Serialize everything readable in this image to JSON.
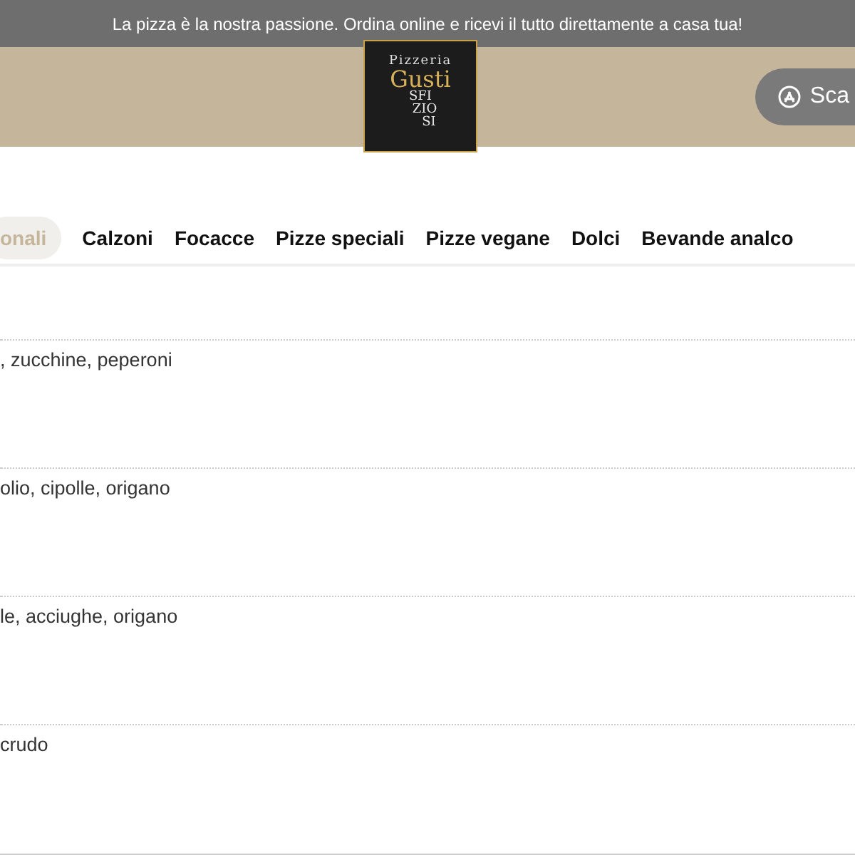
{
  "announcement": "La pizza è la nostra passione. Ordina online e ricevi il tutto direttamente a casa tua!",
  "logo": {
    "top": "Pizzeria",
    "name": "Gusti",
    "lines": [
      "SFI",
      "ZIO",
      "SI"
    ]
  },
  "header_button": {
    "label": "Sca"
  },
  "tabs": [
    {
      "label": "onali",
      "selected": true
    },
    {
      "label": "Calzoni",
      "selected": false
    },
    {
      "label": "Focacce",
      "selected": false
    },
    {
      "label": "Pizze speciali",
      "selected": false
    },
    {
      "label": "Pizze vegane",
      "selected": false
    },
    {
      "label": "Dolci",
      "selected": false
    },
    {
      "label": "Bevande analco",
      "selected": false
    }
  ],
  "items": [
    {
      "description": ", zucchine, peperoni"
    },
    {
      "description": "olio, cipolle, origano"
    },
    {
      "description": "le, acciughe, origano"
    },
    {
      "description": "crudo"
    }
  ]
}
